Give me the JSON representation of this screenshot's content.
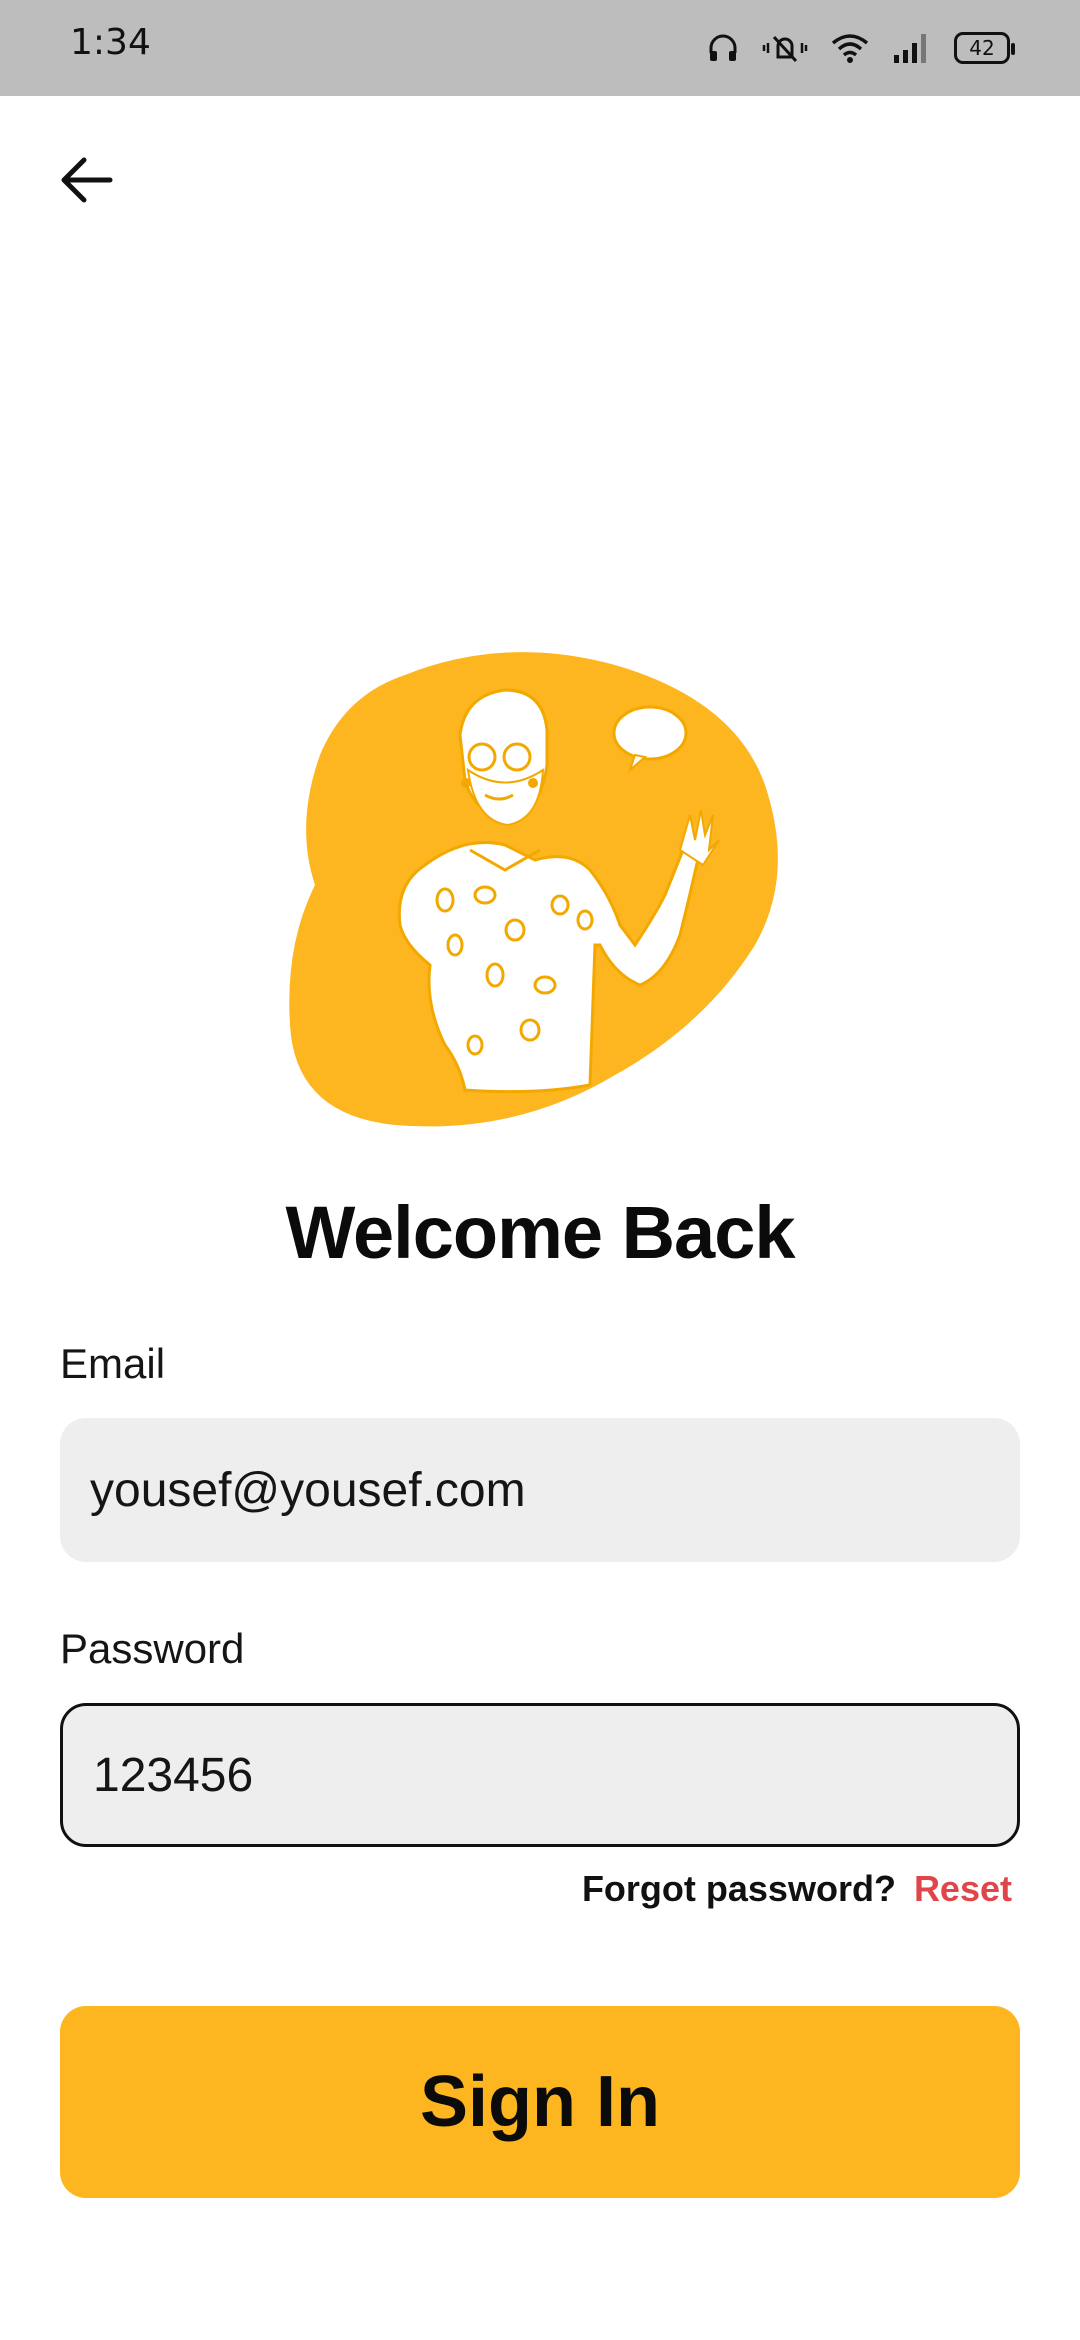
{
  "status_bar": {
    "time": "1:34",
    "battery": "42",
    "icons": [
      "headphones-icon",
      "vibrate-mute-icon",
      "wifi-icon",
      "signal-icon",
      "battery-icon"
    ]
  },
  "header": {
    "back_icon": "arrow-left-icon"
  },
  "illustration": {
    "name": "waving-man-illustration",
    "blob_color": "#FDB520"
  },
  "title": "Welcome Back",
  "form": {
    "email_label": "Email",
    "email_value": "yousef@yousef.com",
    "password_label": "Password",
    "password_value": "123456",
    "forgot_text": "Forgot password?",
    "reset_label": "Reset",
    "signin_label": "Sign In"
  },
  "colors": {
    "accent": "#FDB520",
    "link": "#E0454A",
    "field_bg": "#EEEEEE"
  }
}
